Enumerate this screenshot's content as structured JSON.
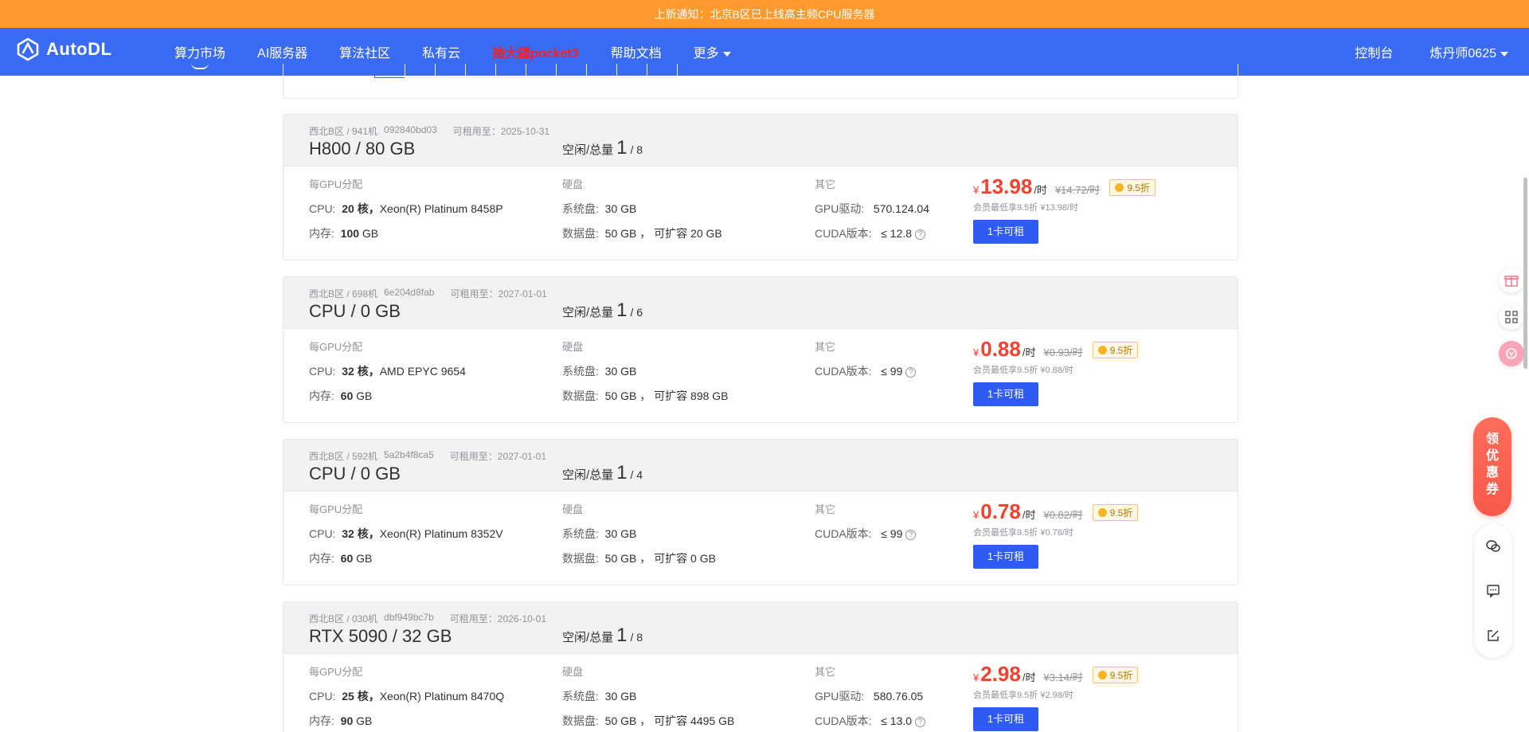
{
  "notice": {
    "text": "上新通知：北京B区已上线高主频CPU服务器"
  },
  "brand": {
    "name": "AutoDL"
  },
  "nav": {
    "items": [
      {
        "label": "算力市场"
      },
      {
        "label": "AI服务器"
      },
      {
        "label": "算法社区"
      },
      {
        "label": "私有云"
      },
      {
        "label": "抽大疆pocket3"
      },
      {
        "label": "帮助文档"
      },
      {
        "label": "更多"
      }
    ],
    "console": "控制台",
    "user": "炼丹师0625"
  },
  "labels": {
    "idle_total": "空闲/总量",
    "per_gpu": "每GPU分配",
    "disk": "硬盘",
    "other": "其它",
    "cpu": "CPU:",
    "mem": "内存:",
    "sys_disk": "系统盘:",
    "data_disk": "数据盘:",
    "gpu_driver": "GPU驱动:",
    "cuda": "CUDA版本:",
    "per_hour": "/时",
    "rent_prefix": "可租用至：",
    "expand": "可扩容",
    "member_prefix": "会员最低享9.5折",
    "coupon": "领优惠券"
  },
  "cards": [
    {
      "region": "西北B区 / 941机",
      "machine_id": "092840bd03",
      "rent_until": "可租用至：2025-10-31",
      "title": "H800 / 80 GB",
      "idle": "1",
      "total": "/ 8",
      "cpu_cores": "20 核，",
      "cpu_model": "Xeon(R) Platinum 8458P",
      "mem": "100",
      "mem_unit": " GB",
      "sys_disk": "30 GB",
      "data_disk": "50 GB ，",
      "expand": " 20 GB",
      "driver": "570.124.04",
      "cuda": "≤ 12.8",
      "price": "13.98",
      "orig": "¥14.72/时",
      "discount": "9.5折",
      "member_price": "会员最低享9.5折 ¥13.98/时",
      "btn": "1卡可租"
    },
    {
      "region": "西北B区 / 698机",
      "machine_id": "6e204d8fab",
      "rent_until": "可租用至：2027-01-01",
      "title": "CPU / 0 GB",
      "idle": "1",
      "total": "/ 6",
      "cpu_cores": "32 核，",
      "cpu_model": "AMD EPYC 9654",
      "mem": "60",
      "mem_unit": " GB",
      "sys_disk": "30 GB",
      "data_disk": "50 GB ，",
      "expand": " 898 GB",
      "driver": "",
      "cuda": "≤ 99",
      "price": "0.88",
      "orig": "¥0.93/时",
      "discount": "9.5折",
      "member_price": "会员最低享9.5折 ¥0.88/时",
      "btn": "1卡可租"
    },
    {
      "region": "西北B区 / 592机",
      "machine_id": "5a2b4f8ca5",
      "rent_until": "可租用至：2027-01-01",
      "title": "CPU / 0 GB",
      "idle": "1",
      "total": "/ 4",
      "cpu_cores": "32 核，",
      "cpu_model": "Xeon(R) Platinum 8352V",
      "mem": "60",
      "mem_unit": " GB",
      "sys_disk": "30 GB",
      "data_disk": "50 GB ，",
      "expand": " 0 GB",
      "driver": "",
      "cuda": "≤ 99",
      "price": "0.78",
      "orig": "¥0.82/时",
      "discount": "9.5折",
      "member_price": "会员最低享9.5折 ¥0.78/时",
      "btn": "1卡可租"
    },
    {
      "region": "西北B区 / 030机",
      "machine_id": "dbf949bc7b",
      "rent_until": "可租用至：2026-10-01",
      "title": "RTX 5090 / 32 GB",
      "idle": "1",
      "total": "/ 8",
      "cpu_cores": "25 核，",
      "cpu_model": "Xeon(R) Platinum 8470Q",
      "mem": "90",
      "mem_unit": " GB",
      "sys_disk": "30 GB",
      "data_disk": "50 GB ，",
      "expand": " 4495 GB",
      "driver": "580.76.05",
      "cuda": "≤ 13.0",
      "price": "2.98",
      "orig": "¥3.14/时",
      "discount": "9.5折",
      "member_price": "会员最低享9.5折 ¥2.98/时",
      "btn": "1卡可租"
    }
  ],
  "colors": {
    "nav_bg": "#3a6bf5",
    "notice_bg": "#ff9a2e",
    "price": "#f5412e",
    "button": "#2f5cf0"
  }
}
